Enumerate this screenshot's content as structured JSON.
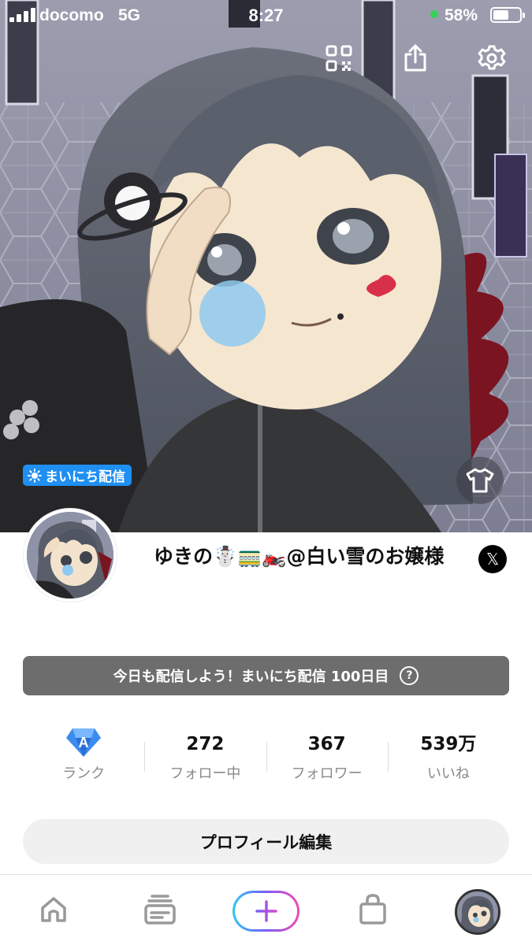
{
  "status_bar": {
    "carrier": "docomo",
    "network": "5G",
    "time": "8:27",
    "battery": "58%",
    "battery_level": 0.58
  },
  "hero": {
    "daily_badge": "まいにち配信"
  },
  "profile": {
    "display_name": "ゆきの☃️🚃🏍️@白い雪のお嬢様"
  },
  "banner": {
    "text": "今日も配信しよう！まいにち配信 100日目",
    "help": "?"
  },
  "stats": [
    {
      "key": "rank",
      "value": "",
      "label": "ランク",
      "rank_letter": "A"
    },
    {
      "key": "following",
      "value": "272",
      "label": "フォロー中"
    },
    {
      "key": "followers",
      "value": "367",
      "label": "フォロワー"
    },
    {
      "key": "likes",
      "value": "539万",
      "label": "いいね"
    }
  ],
  "edit_button": "プロフィール編集",
  "x_link": "𝕏",
  "colors": {
    "badge_blue": "#1f8ff2",
    "banner_gray": "#6d6d6d",
    "tab_gradient": [
      "#2ec5f5",
      "#7b5cf5",
      "#f24bb1"
    ]
  },
  "icons": {
    "top": [
      "qr-code-icon",
      "share-icon",
      "settings-gear-icon"
    ],
    "tabs": [
      "home-icon",
      "feed-icon",
      "plus-icon",
      "shop-bag-icon",
      "profile-avatar"
    ]
  }
}
